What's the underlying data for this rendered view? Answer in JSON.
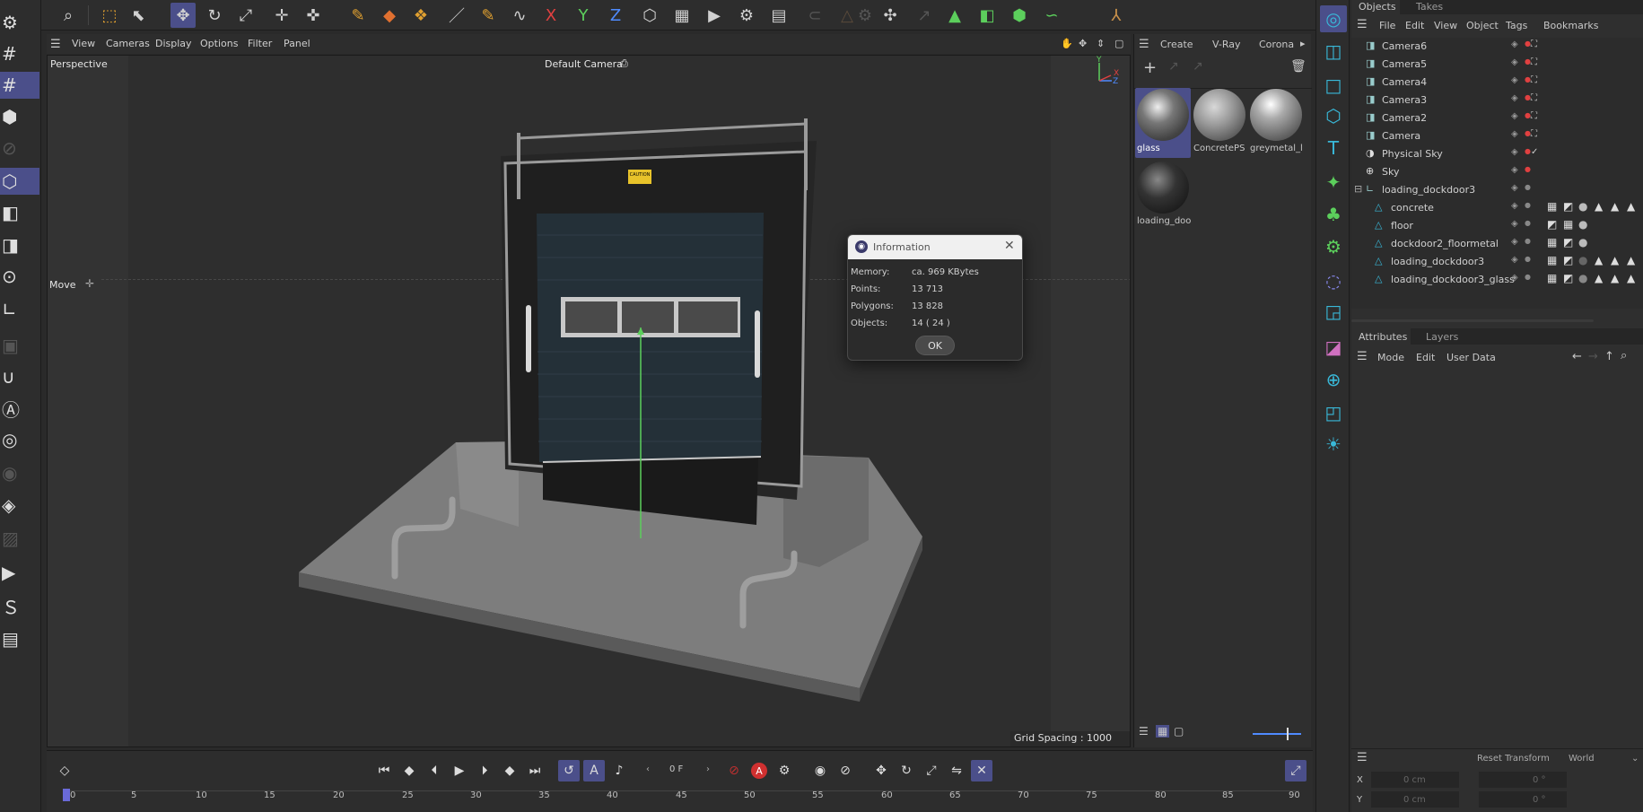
{
  "toolbar": {
    "axis_x": "X",
    "axis_y": "Y",
    "axis_z": "Z"
  },
  "viewport": {
    "menu": [
      "View",
      "Cameras",
      "Display",
      "Options",
      "Filter",
      "Panel"
    ],
    "view_name": "Perspective",
    "camera_name": "Default Camera",
    "camera_icon": "camera-icon",
    "tool_label": "Move",
    "grid_spacing": "Grid Spacing : 1000 cm",
    "axis_labels": {
      "x": "X",
      "y": "Y",
      "z": "Z"
    },
    "door_sign": "CAUTION"
  },
  "material_manager": {
    "menu": [
      "Create",
      "V-Ray",
      "Corona"
    ],
    "materials": [
      {
        "name": "glass",
        "selected": true
      },
      {
        "name": "ConcretePS",
        "selected": false
      },
      {
        "name": "greymetal_l",
        "selected": false
      },
      {
        "name": "loading_doo",
        "selected": false
      }
    ]
  },
  "object_manager": {
    "tabs": [
      "Objects",
      "Takes"
    ],
    "menu": [
      "File",
      "Edit",
      "View",
      "Object",
      "Tags",
      "Bookmarks"
    ],
    "objects": [
      {
        "name": "Camera6",
        "type": "camera-icon",
        "indent": 0
      },
      {
        "name": "Camera5",
        "type": "camera-icon",
        "indent": 0
      },
      {
        "name": "Camera4",
        "type": "camera-icon",
        "indent": 0
      },
      {
        "name": "Camera3",
        "type": "camera-icon",
        "indent": 0
      },
      {
        "name": "Camera2",
        "type": "camera-icon",
        "indent": 0
      },
      {
        "name": "Camera",
        "type": "camera-icon",
        "indent": 0
      },
      {
        "name": "Physical Sky",
        "type": "physical-sky-icon",
        "indent": 0
      },
      {
        "name": "Sky",
        "type": "sky-icon",
        "indent": 0
      },
      {
        "name": "loading_dockdoor3",
        "type": "null-icon",
        "indent": 0
      },
      {
        "name": "concrete",
        "type": "polygon-icon",
        "indent": 1
      },
      {
        "name": "floor",
        "type": "polygon-icon",
        "indent": 1
      },
      {
        "name": "dockdoor2_floormetal",
        "type": "polygon-icon",
        "indent": 1
      },
      {
        "name": "loading_dockdoor3",
        "type": "polygon-icon",
        "indent": 1
      },
      {
        "name": "loading_dockdoor3_glass",
        "type": "polygon-icon",
        "indent": 1
      }
    ]
  },
  "attributes": {
    "tabs": [
      "Attributes",
      "Layers"
    ],
    "menu": [
      "Mode",
      "Edit",
      "User Data"
    ]
  },
  "coordinates": {
    "reset_label": "Reset Transform",
    "space": "World",
    "rows": [
      {
        "axis": "X",
        "pos": "0 cm",
        "rot": "0 °"
      },
      {
        "axis": "Y",
        "pos": "0 cm",
        "rot": "0 °"
      }
    ]
  },
  "timeline": {
    "frame": "0 F",
    "ruler": [
      "0",
      "5",
      "10",
      "15",
      "20",
      "25",
      "30",
      "35",
      "40",
      "45",
      "50",
      "55",
      "60",
      "65",
      "70",
      "75",
      "80",
      "85",
      "90"
    ]
  },
  "dialog": {
    "title": "Information",
    "rows": [
      {
        "label": "Memory:",
        "value": "ca. 969 KBytes"
      },
      {
        "label": "Points:",
        "value": "13 713"
      },
      {
        "label": "Polygons:",
        "value": "13 828"
      },
      {
        "label": "Objects:",
        "value": "14 ( 24 )"
      }
    ],
    "ok": "OK"
  },
  "colors": {
    "accent": "#4b4f8a",
    "axis_x": "#e04040",
    "axis_y": "#5ccf5c",
    "axis_z": "#4f8bff",
    "palette_icon": "#39b8d8"
  }
}
